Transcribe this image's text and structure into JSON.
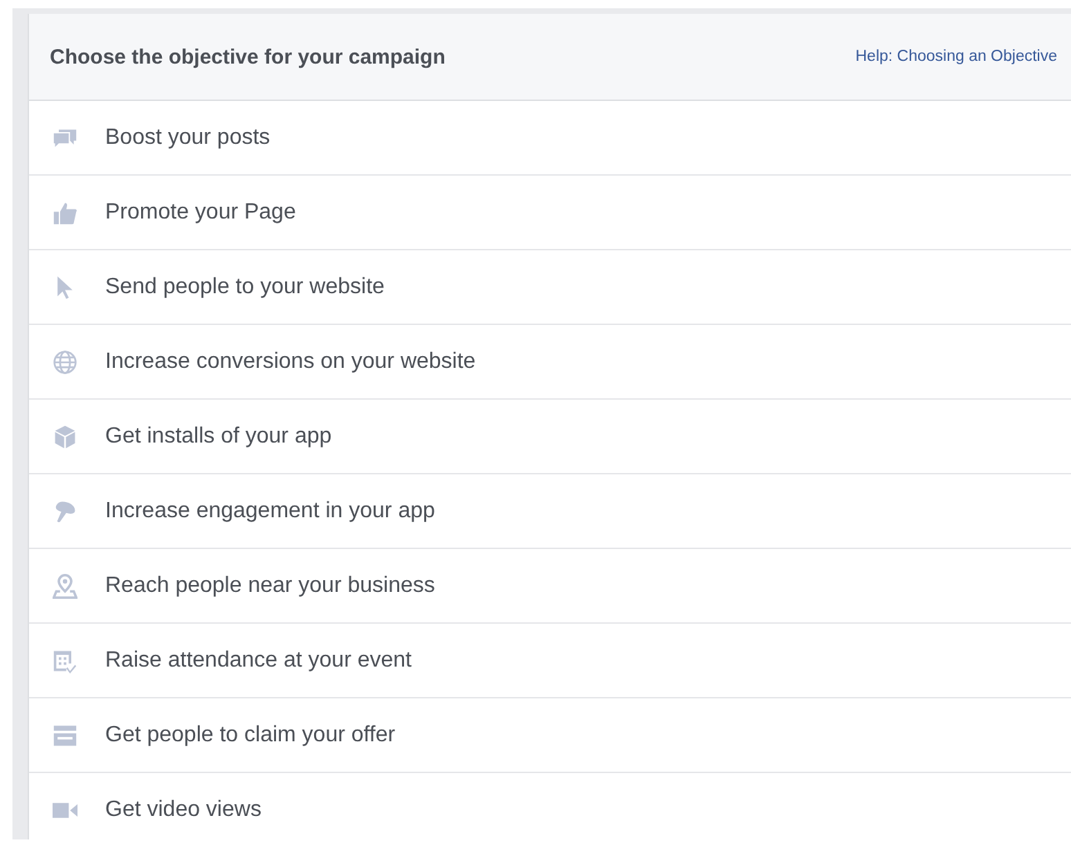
{
  "header": {
    "title": "Choose the objective for your campaign",
    "help_link": "Help: Choosing an Objective"
  },
  "objectives": [
    {
      "kind": "posts",
      "label": "Boost your posts"
    },
    {
      "kind": "like",
      "label": "Promote your Page"
    },
    {
      "kind": "pointer",
      "label": "Send people to your website"
    },
    {
      "kind": "globe",
      "label": "Increase conversions on your website"
    },
    {
      "kind": "box",
      "label": "Get installs of your app"
    },
    {
      "kind": "gamepad",
      "label": "Increase engagement in your app"
    },
    {
      "kind": "pin",
      "label": "Reach people near your business"
    },
    {
      "kind": "calendar",
      "label": "Raise attendance at your event"
    },
    {
      "kind": "store",
      "label": "Get people to claim your offer"
    },
    {
      "kind": "video",
      "label": "Get video views"
    }
  ]
}
